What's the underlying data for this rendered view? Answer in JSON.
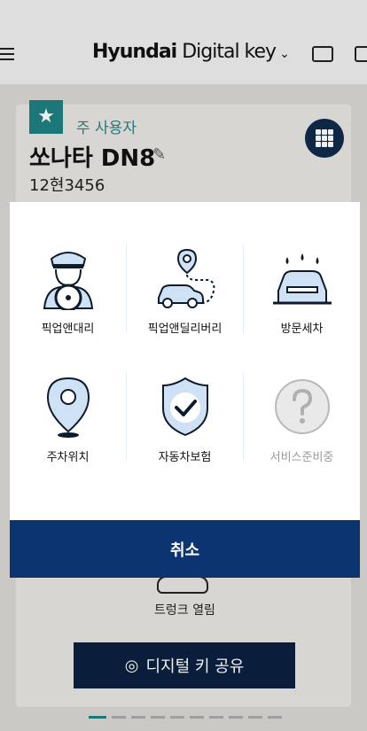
{
  "header": {
    "brand_part1": "Hyundai",
    "brand_part2": " Digital key",
    "chevron": "⌄"
  },
  "vehicle": {
    "role": "주 사용자",
    "name": "쏘나타 DN8",
    "plate": "12현3456"
  },
  "background_actions": {
    "trunk_label": "트렁크 열림",
    "share_label": "디지털 키 공유"
  },
  "services": [
    {
      "label": "픽업앤대리",
      "icon": "driver-icon",
      "enabled": true
    },
    {
      "label": "픽업앤딜리버리",
      "icon": "delivery-route-icon",
      "enabled": true
    },
    {
      "label": "방문세차",
      "icon": "car-wash-icon",
      "enabled": true
    },
    {
      "label": "주차위치",
      "icon": "location-pin-icon",
      "enabled": true
    },
    {
      "label": "자동차보험",
      "icon": "shield-check-icon",
      "enabled": true
    },
    {
      "label": "서비스준비중",
      "icon": "question-icon",
      "enabled": false
    }
  ],
  "modal": {
    "cancel_label": "취소"
  },
  "colors": {
    "accent_navy": "#0b3470",
    "icon_fill": "#cfe1f5",
    "icon_stroke": "#0d1b2a",
    "teal": "#1e7f80"
  }
}
